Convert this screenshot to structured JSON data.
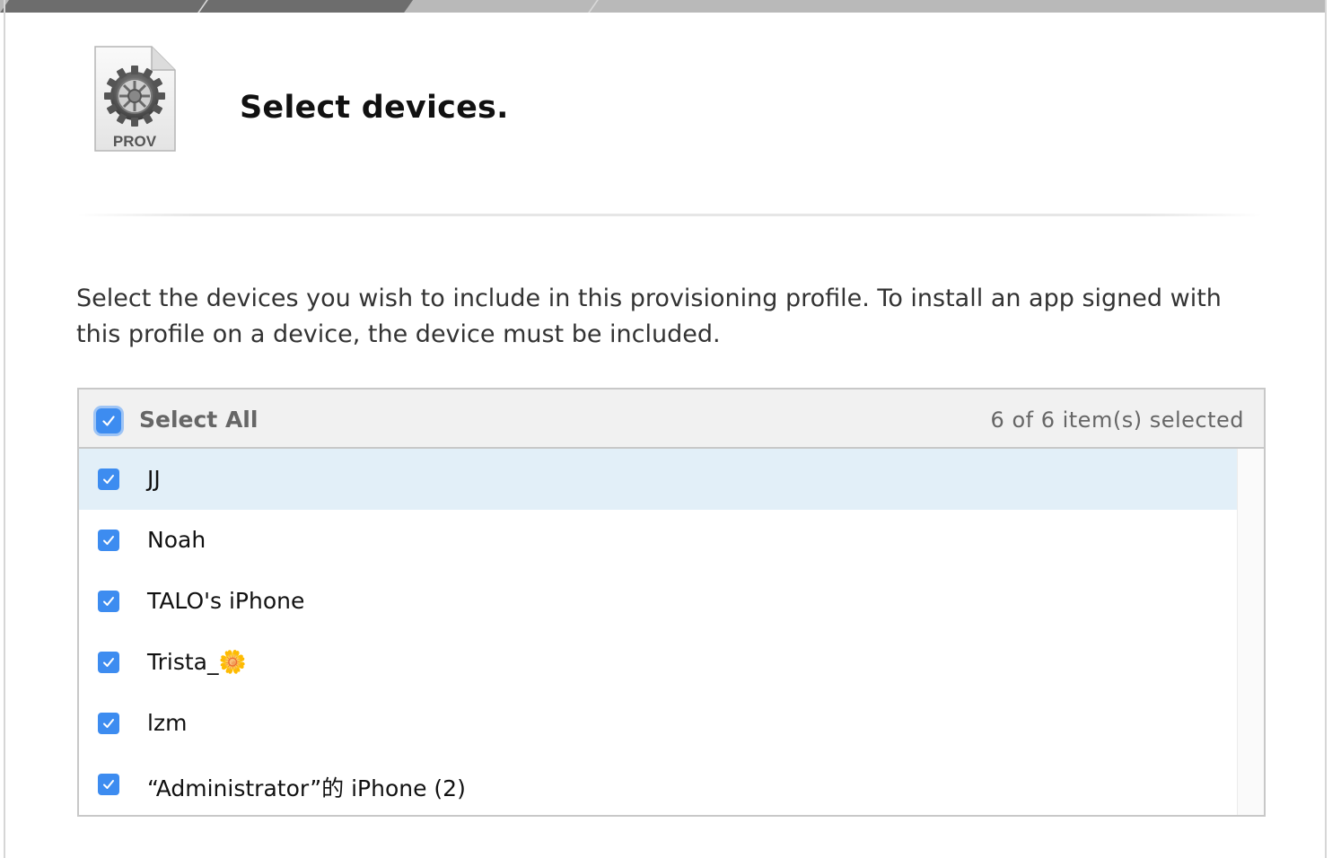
{
  "page": {
    "heading": "Select devices.",
    "icon_label": "PROV",
    "description": "Select the devices you wish to include in this provisioning profile. To install an app signed with this profile on a device, the device must be included."
  },
  "device_list": {
    "select_all_label": "Select All",
    "select_all_checked": true,
    "selection_count": "6 of 6 item(s) selected",
    "devices": [
      {
        "name": "JJ",
        "checked": true,
        "highlighted": true
      },
      {
        "name": "Noah",
        "checked": true,
        "highlighted": false
      },
      {
        "name": "TALO's iPhone",
        "checked": true,
        "highlighted": false
      },
      {
        "name": "Trista_🌼",
        "checked": true,
        "highlighted": false
      },
      {
        "name": "lzm",
        "checked": true,
        "highlighted": false
      },
      {
        "name": "“Administrator”的 iPhone (2)",
        "checked": true,
        "highlighted": false
      }
    ]
  },
  "icons": {
    "profile": "gear-document-icon",
    "checkbox": "checkmark-icon"
  },
  "colors": {
    "checkbox_blue": "#3d8cf0",
    "selected_row": "#e2eff8"
  }
}
